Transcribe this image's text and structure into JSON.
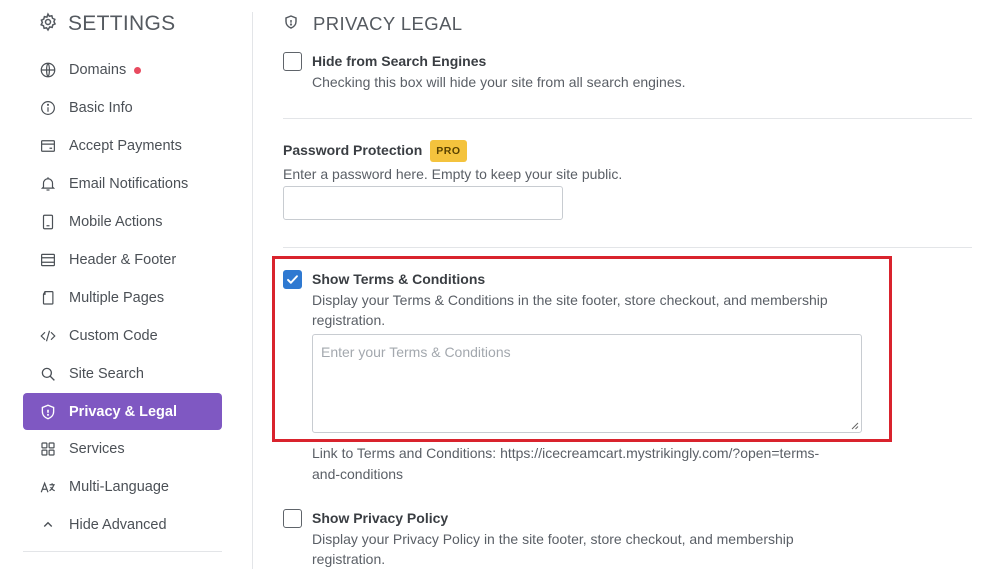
{
  "sidebar": {
    "title": "SETTINGS",
    "items": [
      {
        "label": "Domains",
        "icon": "globe-icon"
      },
      {
        "label": "Basic Info",
        "icon": "info-icon"
      },
      {
        "label": "Accept Payments",
        "icon": "payment-card-icon"
      },
      {
        "label": "Email Notifications",
        "icon": "bell-icon"
      },
      {
        "label": "Mobile Actions",
        "icon": "mobile-icon"
      },
      {
        "label": "Header & Footer",
        "icon": "layout-icon"
      },
      {
        "label": "Multiple Pages",
        "icon": "pages-icon"
      },
      {
        "label": "Custom Code",
        "icon": "code-icon"
      },
      {
        "label": "Site Search",
        "icon": "search-icon"
      },
      {
        "label": "Privacy & Legal",
        "icon": "shield-icon",
        "active": true
      },
      {
        "label": "Services",
        "icon": "grid-icon"
      },
      {
        "label": "Multi-Language",
        "icon": "translate-icon"
      },
      {
        "label": "Hide Advanced",
        "icon": "chevron-up-icon"
      }
    ]
  },
  "main": {
    "title": "PRIVACY LEGAL",
    "hide_search": {
      "label": "Hide from Search Engines",
      "description": "Checking this box will hide your site from all search engines.",
      "checked": false
    },
    "password": {
      "label": "Password Protection",
      "badge": "PRO",
      "description": "Enter a password here. Empty to keep your site public.",
      "value": ""
    },
    "terms": {
      "label": "Show Terms & Conditions",
      "description_line1": "Display your Terms & Conditions in the site footer, store checkout, and membership",
      "description_line2": "registration.",
      "placeholder": "Enter your Terms & Conditions",
      "link_line1": "Link to Terms and Conditions: https://icecreamcart.mystrikingly.com/?open=terms-",
      "link_line2": "and-conditions",
      "checked": true
    },
    "privacy": {
      "label": "Show Privacy Policy",
      "description_line1": "Display your Privacy Policy in the site footer, store checkout, and membership",
      "description_line2": "registration.",
      "checked": false
    }
  },
  "colors": {
    "accent": "#7f58c2",
    "checkbox": "#2f79d1",
    "highlight": "#d9232d",
    "pro_badge": "#f4c33d",
    "notification_dot": "#e84a5f"
  }
}
